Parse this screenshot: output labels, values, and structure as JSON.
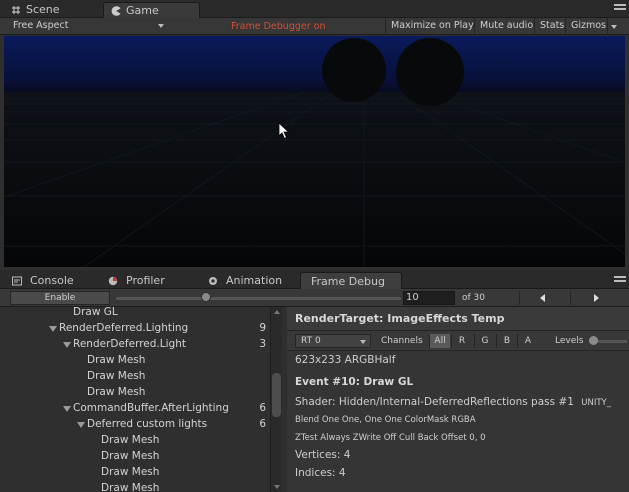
{
  "top_tabs": [
    {
      "label": "Scene",
      "icon": "scene-grid-icon"
    },
    {
      "label": "Game",
      "icon": "game-pacman-icon"
    }
  ],
  "game_toolbar": {
    "aspect": "Free Aspect",
    "frame_debugger_status": "Frame Debugger on",
    "maximize": "Maximize on Play",
    "mute": "Mute audio",
    "stats": "Stats",
    "gizmos": "Gizmos"
  },
  "bottom_tabs": [
    {
      "label": "Console",
      "icon": "console-icon"
    },
    {
      "label": "Profiler",
      "icon": "profiler-icon"
    },
    {
      "label": "Animation",
      "icon": "animation-icon"
    },
    {
      "label": "Frame Debug",
      "icon": ""
    }
  ],
  "frame_debug": {
    "enable_label": "Enable",
    "current_event": "10",
    "total": "of 30",
    "slider_fraction": 0.3
  },
  "tree": [
    {
      "label": "Draw GL",
      "count": "",
      "depth": 0,
      "expanded": false
    },
    {
      "label": "RenderDeferred.Lighting",
      "count": "9",
      "depth": 1,
      "expanded": true
    },
    {
      "label": "RenderDeferred.Light",
      "count": "3",
      "depth": 2,
      "expanded": true
    },
    {
      "label": "Draw Mesh",
      "count": "",
      "depth": 3,
      "expanded": false
    },
    {
      "label": "Draw Mesh",
      "count": "",
      "depth": 3,
      "expanded": false
    },
    {
      "label": "Draw Mesh",
      "count": "",
      "depth": 3,
      "expanded": false
    },
    {
      "label": "CommandBuffer.AfterLighting",
      "count": "6",
      "depth": 1,
      "expanded": true
    },
    {
      "label": "Deferred custom lights",
      "count": "6",
      "depth": 2,
      "expanded": true
    },
    {
      "label": "Draw Mesh",
      "count": "",
      "depth": 4,
      "expanded": false
    },
    {
      "label": "Draw Mesh",
      "count": "",
      "depth": 4,
      "expanded": false
    },
    {
      "label": "Draw Mesh",
      "count": "",
      "depth": 4,
      "expanded": false
    },
    {
      "label": "Draw Mesh",
      "count": "",
      "depth": 4,
      "expanded": false
    }
  ],
  "details": {
    "render_target": "RenderTarget: ImageEffects Temp",
    "rt_select": "RT 0",
    "channels_label": "Channels",
    "channels": [
      "All",
      "R",
      "G",
      "B",
      "A"
    ],
    "levels_label": "Levels",
    "size": "623x233 ARGBHalf",
    "event": "Event #10: Draw GL",
    "shader": "Shader: Hidden/Internal-DeferredReflections pass #1",
    "shader_keyword": "UNITY_",
    "blend": "Blend One One, One One ColorMask RGBA",
    "ztest": "ZTest Always ZWrite Off Cull Back Offset 0, 0",
    "vertices": "Vertices: 4",
    "indices": "Indices: 4"
  }
}
